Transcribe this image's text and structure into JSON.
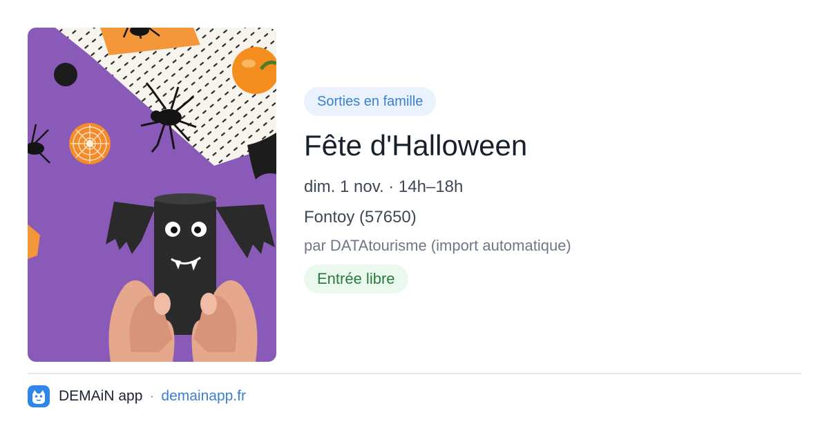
{
  "event": {
    "category": "Sorties en famille",
    "title": "Fête d'Halloween",
    "datetime": "dim. 1 nov. · 14h–18h",
    "location": "Fontoy (57650)",
    "source": "par DATAtourisme (import automatique)",
    "price": "Entrée libre",
    "image_alt": "Halloween craft: paper bat made from a toilet paper roll held in hands on purple background with spiders and pumpkins"
  },
  "footer": {
    "app_name": "DEMAiN app",
    "separator": "·",
    "url": "demainapp.fr",
    "logo_icon": "demain-app-logo-icon"
  },
  "colors": {
    "category_bg": "#eaf2fd",
    "category_text": "#3a7fd0",
    "price_bg": "#ebf8ee",
    "price_text": "#2a7a3e",
    "link": "#3a7fd0",
    "image_background": "#8a5ab8"
  }
}
